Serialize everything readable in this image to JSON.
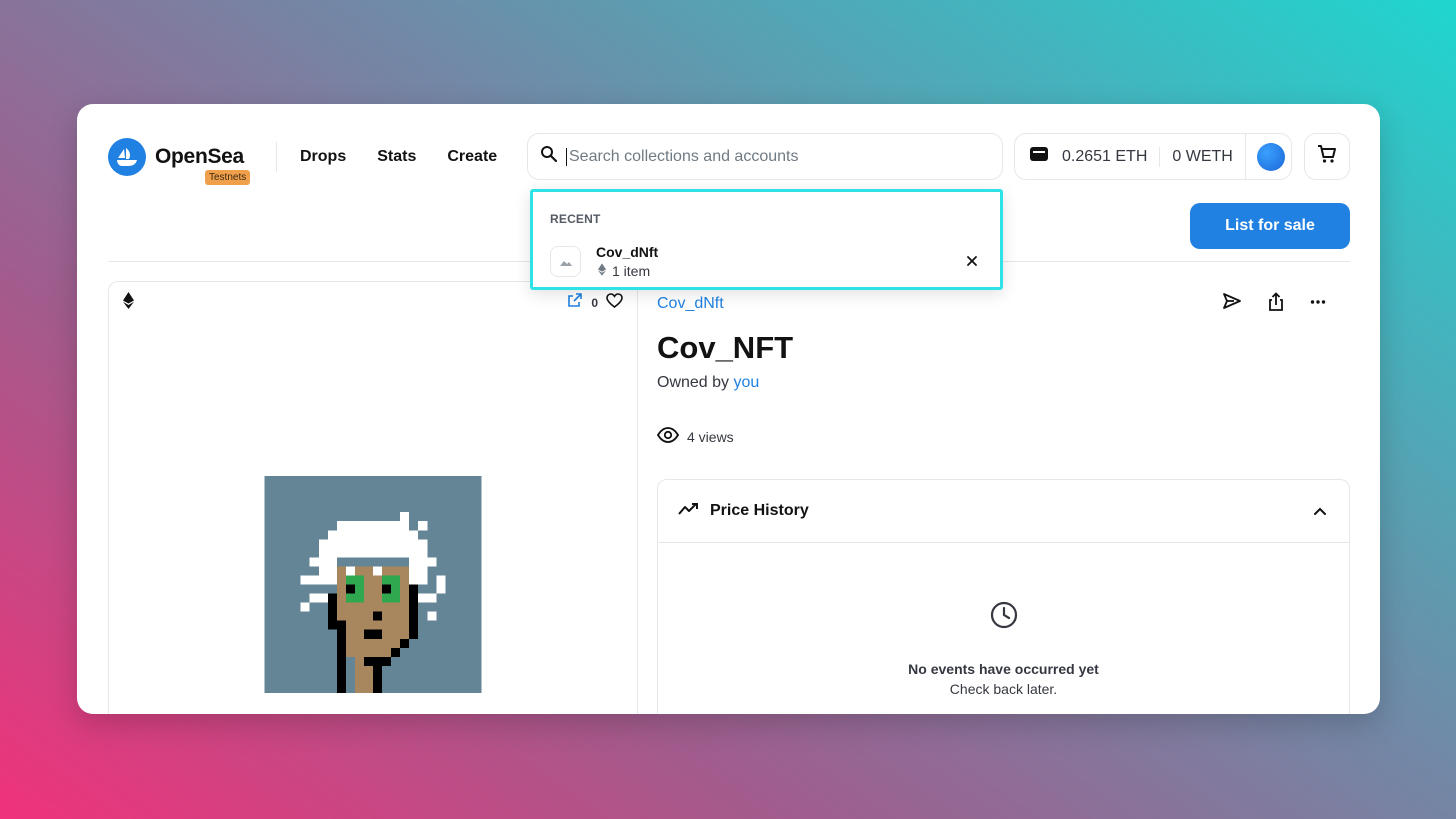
{
  "header": {
    "brand": "OpenSea",
    "badge": "Testnets",
    "nav": [
      "Drops",
      "Stats",
      "Create"
    ],
    "search_placeholder": "Search collections and accounts",
    "wallet": {
      "eth": "0.2651 ETH",
      "weth": "0 WETH"
    },
    "list_for_sale": "List for sale"
  },
  "search_dropdown": {
    "section": "RECENT",
    "items": [
      {
        "name": "Cov_dNft",
        "meta": "1 item"
      }
    ]
  },
  "media": {
    "favorites": "0"
  },
  "item": {
    "collection": "Cov_dNft",
    "title": "Cov_NFT",
    "owned_prefix": "Owned by",
    "owner": "you",
    "views": "4 views"
  },
  "price_history": {
    "title": "Price History",
    "empty_title": "No events have occurred yet",
    "empty_sub": "Check back later."
  },
  "colors": {
    "accent": "#2081e2",
    "dropdown_focus": "#2fe2e6",
    "testnet_badge": "#f0a04b"
  }
}
